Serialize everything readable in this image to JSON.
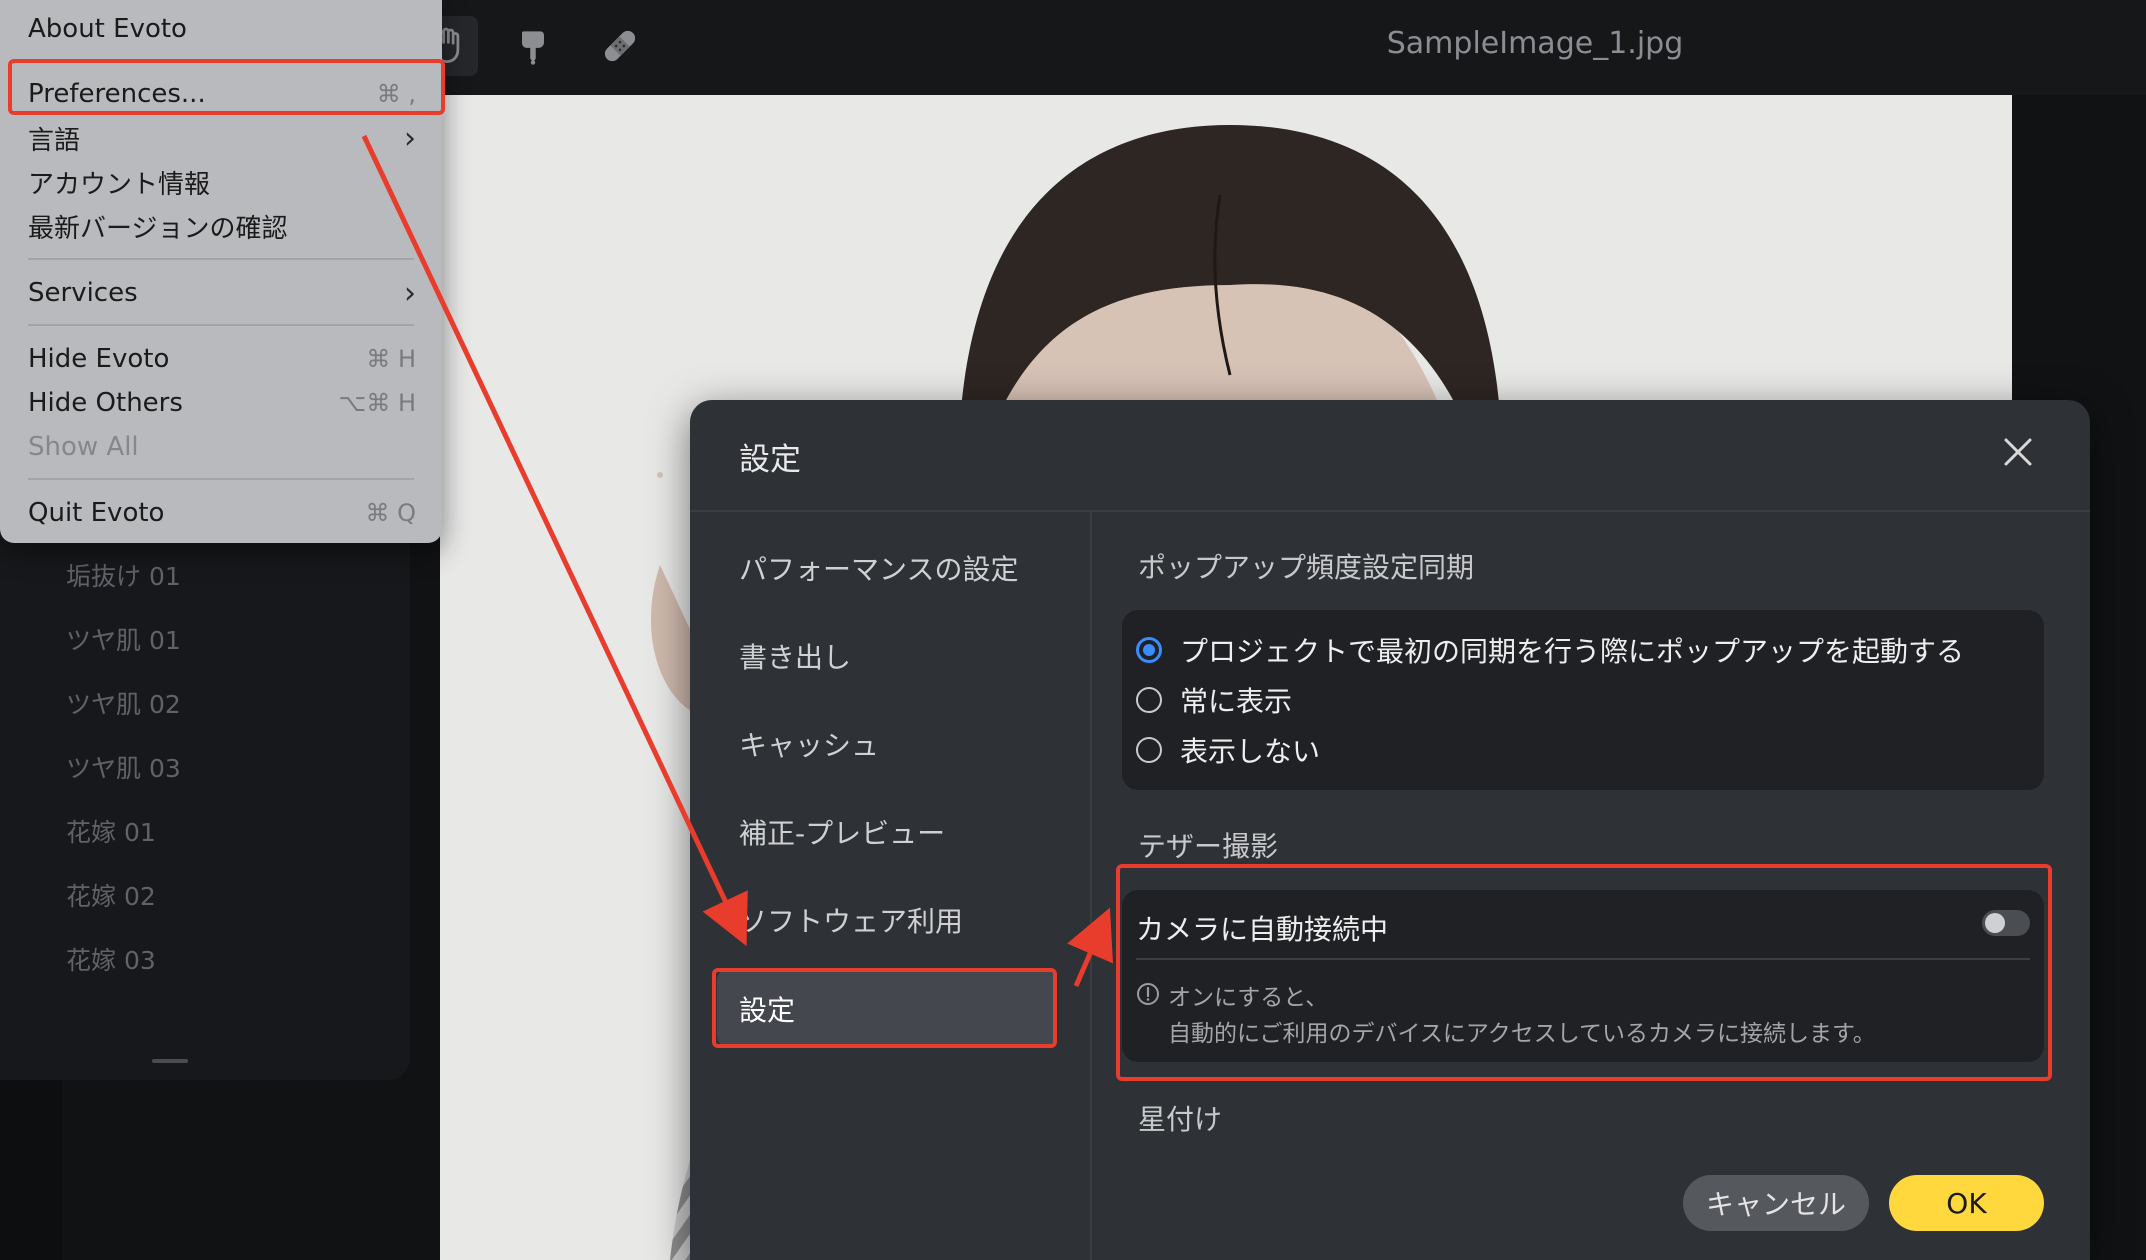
{
  "toolbar": {
    "filename": "SampleImage_1.jpg"
  },
  "app_menu": {
    "items": [
      {
        "label": "About Evoto",
        "shortcut": ""
      },
      {
        "label": "Preferences...",
        "shortcut": "⌘ ,"
      },
      {
        "label": "言語",
        "shortcut": ""
      },
      {
        "label": "アカウント情報",
        "shortcut": ""
      },
      {
        "label": "最新バージョンの確認",
        "shortcut": ""
      },
      {
        "label": "Services",
        "shortcut": ""
      },
      {
        "label": "Hide Evoto",
        "shortcut": "⌘ H"
      },
      {
        "label": "Hide Others",
        "shortcut": "⌥⌘ H"
      },
      {
        "label": "Show All",
        "shortcut": ""
      },
      {
        "label": "Quit Evoto",
        "shortcut": "⌘ Q"
      }
    ]
  },
  "presets": [
    "垢抜け 01",
    "ツヤ肌 01",
    "ツヤ肌 02",
    "ツヤ肌 03",
    "花嫁 01",
    "花嫁 02",
    "花嫁 03"
  ],
  "dialog": {
    "title": "設定",
    "nav": [
      "パフォーマンスの設定",
      "書き出し",
      "キャッシュ",
      "補正-プレビュー",
      "ソフトウェア利用",
      "設定"
    ],
    "popup_section": {
      "title": "ポップアップ頻度設定同期",
      "options": [
        "プロジェクトで最初の同期を行う際にポップアップを起動する",
        "常に表示",
        "表示しない"
      ],
      "selected": 0
    },
    "tether_section": {
      "title": "テザー撮影",
      "toggle_label": "カメラに自動接続中",
      "toggle_on": false,
      "note_line1": "オンにすると、",
      "note_line2": "自動的にご利用のデバイスにアクセスしているカメラに接続します。"
    },
    "rating_section": {
      "title": "星付け"
    },
    "cancel_label": "キャンセル",
    "ok_label": "OK"
  },
  "colors": {
    "highlight": "#e83c2c",
    "accent": "#3a8cff",
    "ok_button": "#ffd83d"
  }
}
